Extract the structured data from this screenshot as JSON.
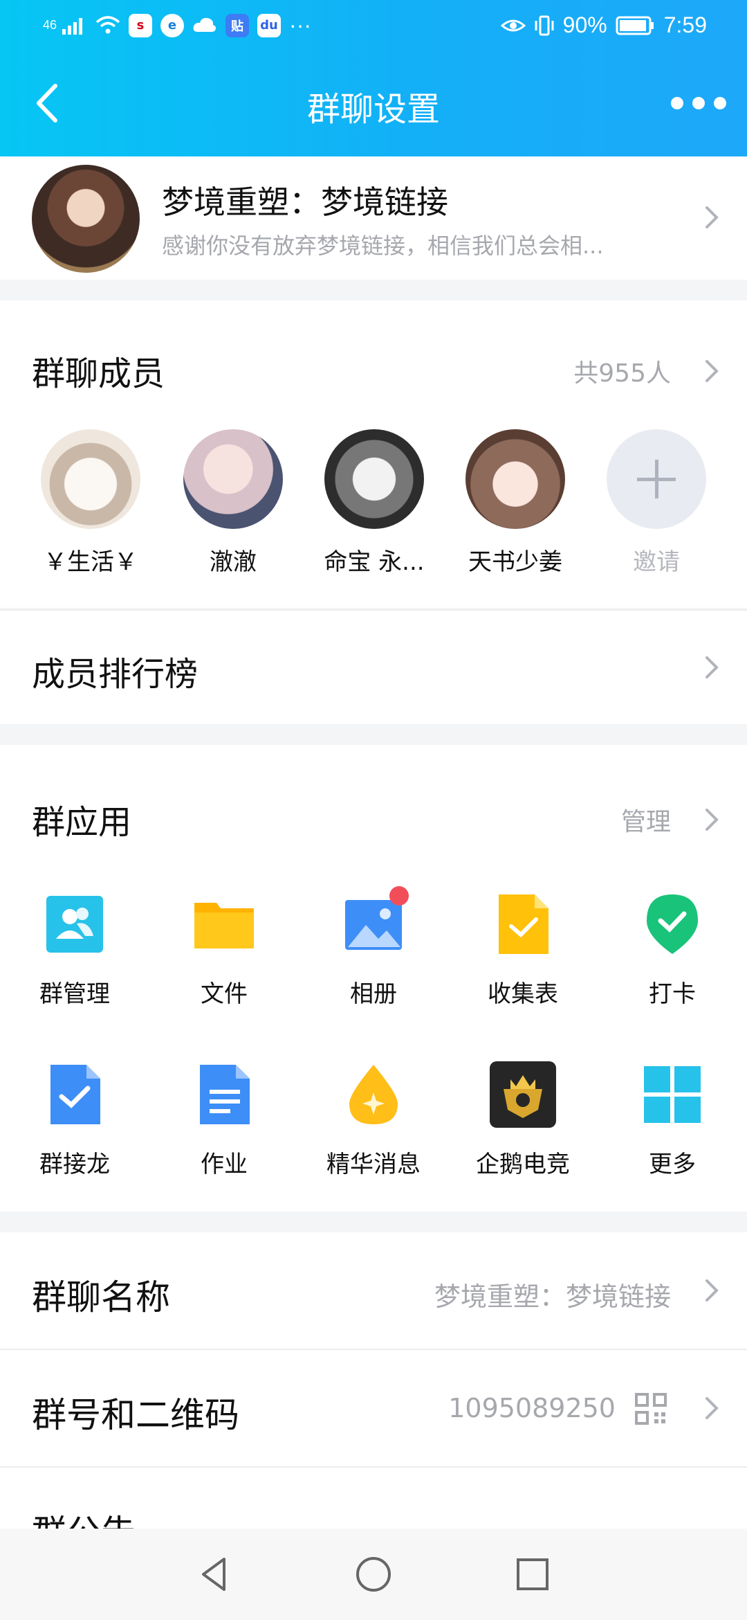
{
  "status": {
    "signal": "46",
    "battery": "90%",
    "time": "7:59",
    "app_badges": [
      "sina",
      "browser",
      "weather",
      "tieba",
      "baidu"
    ],
    "overflow": "···"
  },
  "nav": {
    "title": "群聊设置"
  },
  "group": {
    "name": "梦境重塑：梦境链接",
    "description": "感谢你没有放弃梦境链接，相信我们总会相..."
  },
  "members": {
    "title": "群聊成员",
    "count_label": "共955人",
    "list": [
      {
        "name": "￥生活￥"
      },
      {
        "name": "澈澈"
      },
      {
        "name": "命宝 永..."
      },
      {
        "name": "天书少姜"
      }
    ],
    "invite_label": "邀请"
  },
  "ranking": {
    "title": "成员排行榜"
  },
  "apps": {
    "title": "群应用",
    "manage_label": "管理",
    "items": [
      {
        "label": "群管理",
        "icon": "group-manage-icon",
        "color": "#27c2e9"
      },
      {
        "label": "文件",
        "icon": "folder-icon",
        "color": "#ffc10a"
      },
      {
        "label": "相册",
        "icon": "album-icon",
        "color": "#3d8ef7"
      },
      {
        "label": "收集表",
        "icon": "form-icon",
        "color": "#ffc10a"
      },
      {
        "label": "打卡",
        "icon": "checkin-icon",
        "color": "#19c37a"
      },
      {
        "label": "群接龙",
        "icon": "relay-icon",
        "color": "#3d8ef7"
      },
      {
        "label": "作业",
        "icon": "homework-icon",
        "color": "#3d8ef7"
      },
      {
        "label": "精华消息",
        "icon": "essence-icon",
        "color": "#ffbe18"
      },
      {
        "label": "企鹅电竞",
        "icon": "esports-icon",
        "color": "#262626"
      },
      {
        "label": "更多",
        "icon": "more-apps-icon",
        "color": "#27c2e9"
      }
    ]
  },
  "settings": {
    "name_label": "群聊名称",
    "name_value": "梦境重塑：梦境链接",
    "id_label": "群号和二维码",
    "id_value": "1095089250",
    "notice_label": "群公告"
  },
  "colors": {
    "header_start": "#06c6f4",
    "header_end": "#1ea8f9",
    "badge_red": "#f24e5a"
  }
}
